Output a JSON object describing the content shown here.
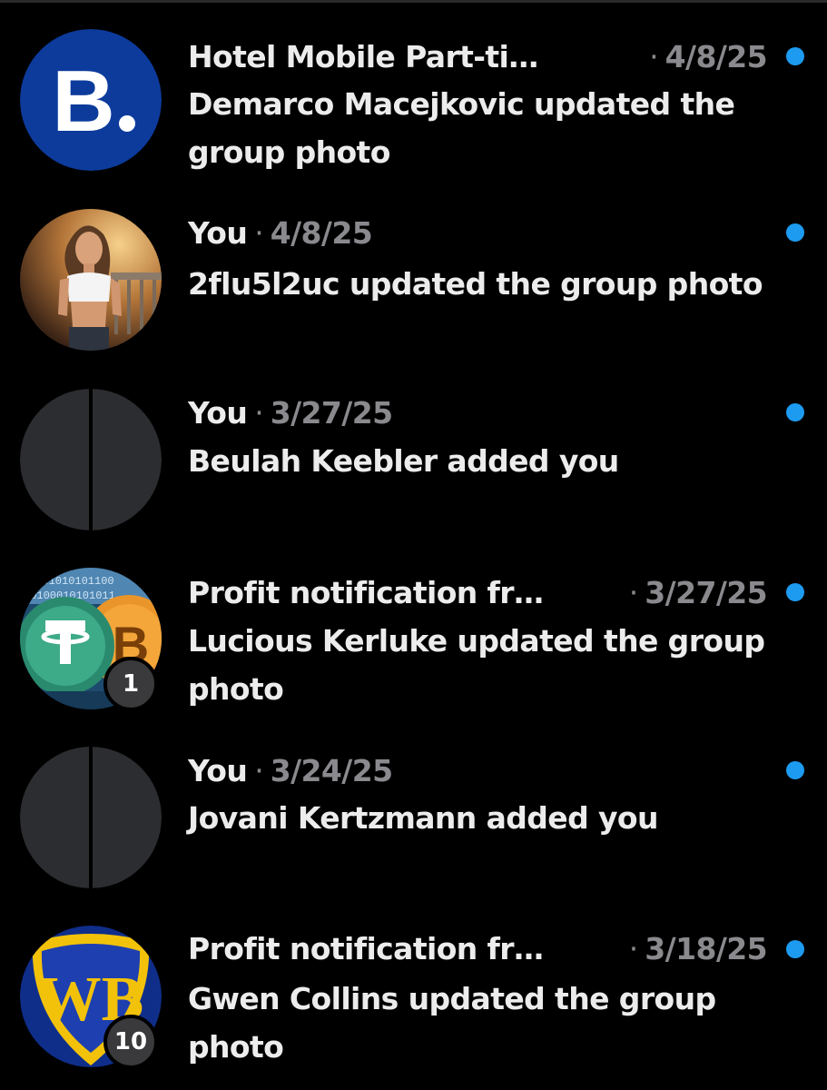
{
  "colors": {
    "background": "#000000",
    "primary_text": "#ececec",
    "secondary_text": "#8a8a8e",
    "unread_dot": "#1d9bf0",
    "badge_bg": "#3a3a3c"
  },
  "conversations": [
    {
      "title": "Hotel Mobile Part-ti…",
      "separator": "·",
      "date": "4/8/25",
      "preview": "Demarco Macejkovic updated the group photo",
      "unread": true,
      "avatar": "booking-logo-avatar",
      "badge": null
    },
    {
      "title": "You",
      "separator": "·",
      "date": "4/8/25",
      "preview": "2flu5l2uc updated the group photo",
      "unread": true,
      "avatar": "profile-photo-avatar",
      "badge": null
    },
    {
      "title": "You",
      "separator": "·",
      "date": "3/27/25",
      "preview": "Beulah Keebler added you",
      "unread": true,
      "avatar": "split-placeholder-avatar",
      "badge": null
    },
    {
      "title": "Profit notification fr…",
      "separator": "·",
      "date": "3/27/25",
      "preview": "Lucious Kerluke updated the group photo",
      "unread": true,
      "avatar": "crypto-coins-avatar",
      "badge": "1"
    },
    {
      "title": "You",
      "separator": "·",
      "date": "3/24/25",
      "preview": "Jovani Kertzmann added you",
      "unread": true,
      "avatar": "split-placeholder-avatar",
      "badge": null
    },
    {
      "title": "Profit notification fr…",
      "separator": "·",
      "date": "3/18/25",
      "preview": "Gwen Collins updated the group photo",
      "unread": true,
      "avatar": "wb-shield-avatar",
      "badge": "10"
    }
  ]
}
